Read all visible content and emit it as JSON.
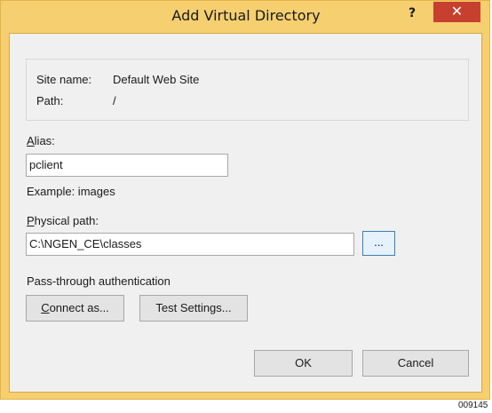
{
  "window": {
    "title": "Add Virtual Directory",
    "help_label": "?",
    "close_label": "✕"
  },
  "info": {
    "site_name_label": "Site name:",
    "site_name_value": "Default Web Site",
    "path_label": "Path:",
    "path_value": "/"
  },
  "alias": {
    "label_first": "A",
    "label_rest": "lias:",
    "value": "pclient",
    "example": "Example: images"
  },
  "physical_path": {
    "label_first": "P",
    "label_rest": "hysical path:",
    "value": "C:\\NGEN_CE\\classes",
    "browse_label": "..."
  },
  "auth": {
    "label": "Pass-through authentication",
    "connect_first": "C",
    "connect_rest": "onnect as...",
    "test_label": "Test Settings..."
  },
  "buttons": {
    "ok": "OK",
    "cancel": "Cancel"
  },
  "figure_id": "009145",
  "colors": {
    "frame": "#f5cf70",
    "close": "#c7402f",
    "client": "#f0f0f0"
  }
}
